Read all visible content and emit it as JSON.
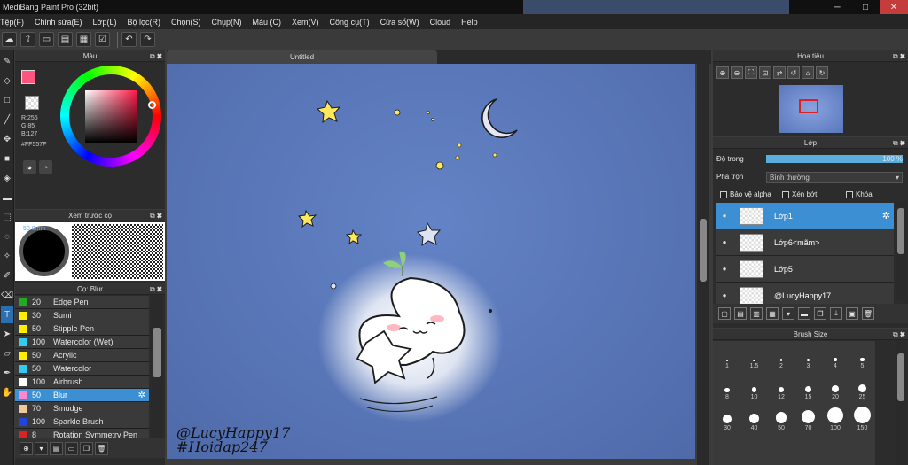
{
  "window": {
    "title": "MediBang Paint Pro (32bit)",
    "controls": [
      "─",
      "□",
      "✕"
    ]
  },
  "menu": [
    "Tệp(F)",
    "Chỉnh sửa(E)",
    "Lớp(L)",
    "Bộ lọc(R)",
    "Chọn(S)",
    "Chụp(N)",
    "Màu (C)",
    "Xem(V)",
    "Công cụ(T)",
    "Cửa sổ(W)",
    "Cloud",
    "Help"
  ],
  "color_panel": {
    "title": "Màu",
    "r": "R:255",
    "g": "G:85",
    "b": "B:127",
    "hex": "#FF557F",
    "fg_color": "#ff557f"
  },
  "preview_panel": {
    "title": "Xem trước cọ",
    "size": "50.0mm"
  },
  "brush_panel": {
    "title": "Cọ: Blur",
    "items": [
      {
        "size": "20",
        "name": "Edge Pen",
        "color": "#22aa22"
      },
      {
        "size": "30",
        "name": "Sumi",
        "color": "#ffee00"
      },
      {
        "size": "50",
        "name": "Stipple Pen",
        "color": "#ffee00"
      },
      {
        "size": "100",
        "name": "Watercolor (Wet)",
        "color": "#33ccee"
      },
      {
        "size": "50",
        "name": "Acrylic",
        "color": "#ffee00"
      },
      {
        "size": "50",
        "name": "Watercolor",
        "color": "#33ccee"
      },
      {
        "size": "100",
        "name": "Airbrush",
        "color": "#ffffff"
      },
      {
        "size": "50",
        "name": "Blur",
        "color": "#ff88cc"
      },
      {
        "size": "70",
        "name": "Smudge",
        "color": "#f0c8a0"
      },
      {
        "size": "100",
        "name": "Sparkle Brush",
        "color": "#2244dd"
      },
      {
        "size": "8",
        "name": "Rotation Symmetry Pen",
        "color": "#dd2222"
      }
    ],
    "selected_index": 7
  },
  "canvas": {
    "tab_title": "Untitled",
    "watermark_line1": "@LucyHappy17",
    "watermark_line2": "#Hoidap247"
  },
  "navigator": {
    "title": "Hoa tiêu"
  },
  "layer_panel": {
    "title": "Lớp",
    "opacity_label": "Độ trong",
    "opacity_value": "100 %",
    "opacity": 1.0,
    "blend_label": "Pha trộn",
    "blend_value": "Bình thường",
    "protect_alpha": "Bảo vệ alpha",
    "clip": "Xén bớt",
    "lock": "Khóa",
    "layers": [
      "Lớp1",
      "Lớp6<mãm>",
      "Lớp5",
      "@LucyHappy17"
    ],
    "selected_index": 0
  },
  "brush_size_panel": {
    "title": "Brush Size",
    "sizes": [
      "1",
      "1.5",
      "2",
      "3",
      "4",
      "5",
      "8",
      "10",
      "12",
      "15",
      "20",
      "25",
      "30",
      "40",
      "50",
      "70",
      "100",
      "150"
    ]
  }
}
